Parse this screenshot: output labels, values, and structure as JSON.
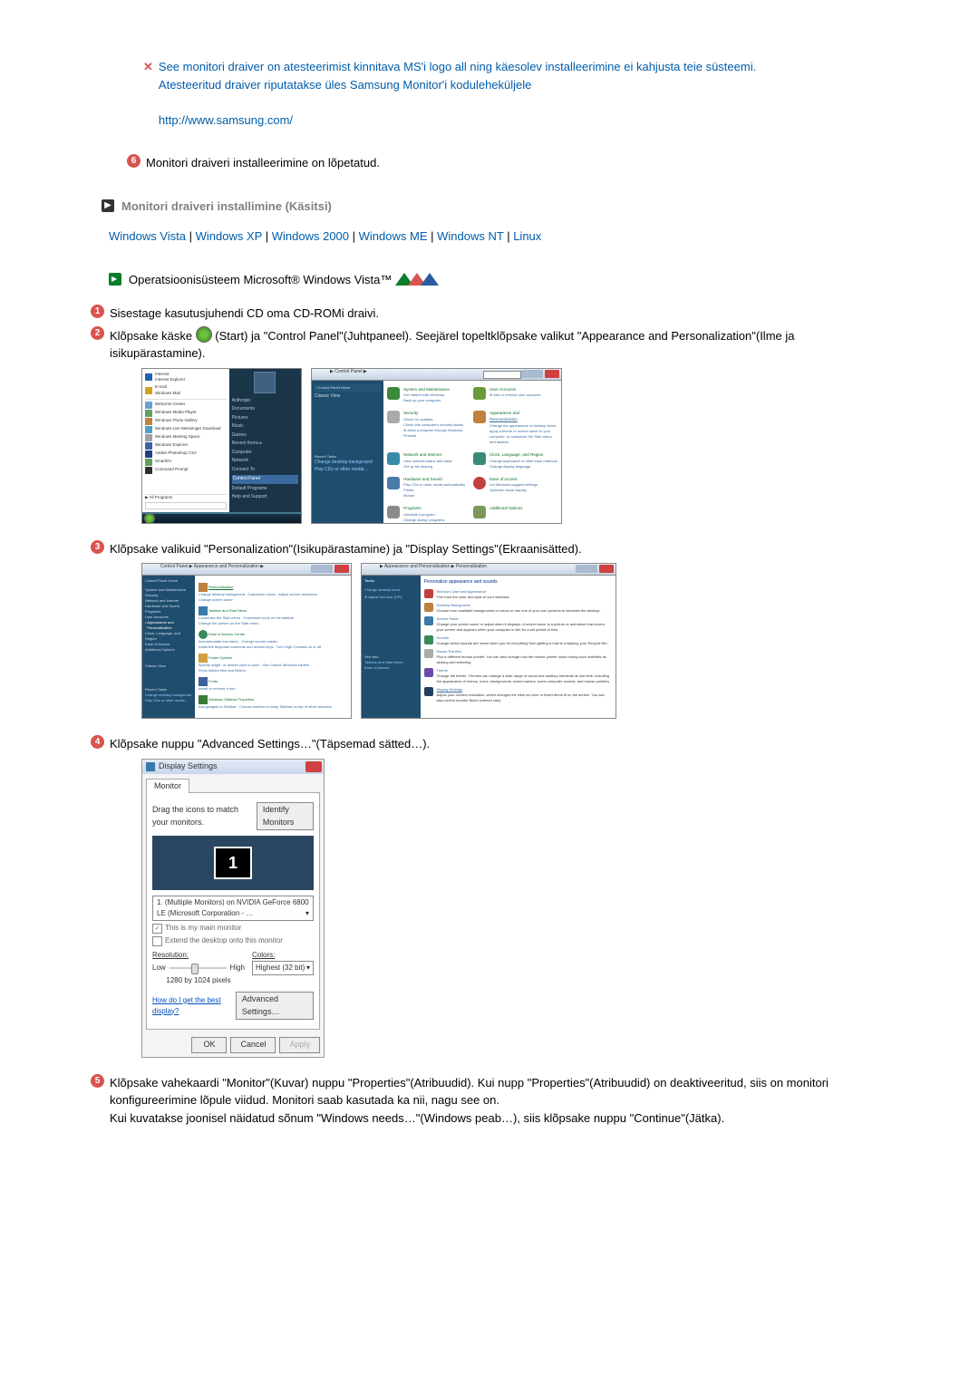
{
  "intro": {
    "line1": "See monitori draiver on atesteerimist kinnitava MS'i logo all ning käesolev installeerimine ei kahjusta teie süsteemi.",
    "line2": "Atesteeritud draiver riputatakse üles Samsung Monitor'i koduleheküljele",
    "url": "http://www.samsung.com/"
  },
  "step6": "Monitori draiveri installeerimine on lõpetatud.",
  "manual_heading": "Monitori draiveri installimine (Käsitsi)",
  "os_links": {
    "vista": "Windows Vista",
    "xp": "Windows XP",
    "w2000": "Windows 2000",
    "me": "Windows ME",
    "nt": "Windows NT",
    "linux": "Linux"
  },
  "os_label": "Operatsioonisüsteem Microsoft® Windows Vista™",
  "steps": {
    "s1": "Sisestage kasutusjuhendi CD oma CD-ROMi draivi.",
    "s2a": "Klõpsake käske ",
    "s2b": "(Start) ja \"Control Panel\"(Juhtpaneel). Seejärel topeltklõpsake valikut \"Appearance and Personalization\"(Ilme ja isikupärastamine).",
    "s3": "Klõpsake valikuid \"Personalization\"(Isikupärastamine) ja \"Display Settings\"(Ekraanisätted).",
    "s4": "Klõpsake nuppu \"Advanced Settings…\"(Täpsemad sätted…).",
    "s5a": "Klõpsake vahekaardi \"Monitor\"(Kuvar) nuppu \"Properties\"(Atribuudid). Kui nupp \"Properties\"(Atribuudid) on deaktiveeritud, siis on monitori konfigureerimine lõpule viidud. Monitori saab kasutada ka nii, nagu see on.",
    "s5b": "Kui kuvatakse joonisel näidatud sõnum \"Windows needs…\"(Windows peab…), siis klõpsake nuppu \"Continue\"(Jätka)."
  },
  "dialog": {
    "title": "Display Settings",
    "tab": "Monitor",
    "drag_text": "Drag the icons to match your monitors.",
    "identify": "Identify Monitors",
    "monitor_num": "1",
    "device": "1. (Multiple Monitors) on NVIDIA GeForce 6800 LE (Microsoft Corporation - …",
    "chk1": "This is my main monitor",
    "chk2": "Extend the desktop onto this monitor",
    "res_label": "Resolution:",
    "low": "Low",
    "high": "High",
    "res_value": "1280 by 1024 pixels",
    "colors_label": "Colors:",
    "colors_value": "Highest (32 bit)",
    "help_link": "How do I get the best display?",
    "adv": "Advanced Settings…",
    "ok": "OK",
    "cancel": "Cancel",
    "apply": "Apply"
  }
}
